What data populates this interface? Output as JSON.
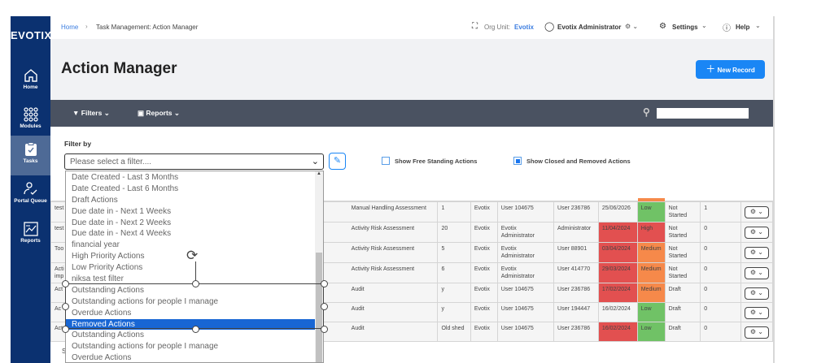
{
  "sidebar": {
    "logo": "EVOTIX",
    "items": [
      {
        "label": "Home",
        "icon": "home-icon"
      },
      {
        "label": "Modules",
        "icon": "grid-icon"
      },
      {
        "label": "Tasks",
        "icon": "clipboard-check-icon",
        "active": true
      },
      {
        "label": "Portal Queue",
        "icon": "user-check-icon"
      },
      {
        "label": "Reports",
        "icon": "chart-icon"
      }
    ]
  },
  "header": {
    "breadcrumb_home": "Home",
    "breadcrumb_current": "Task Management: Action Manager",
    "org_unit_label": "Org Unit:",
    "org_unit_value": "Evotix",
    "user": "Evotix Administrator",
    "settings": "Settings",
    "help": "Help"
  },
  "page": {
    "title": "Action Manager",
    "new_record": "New Record"
  },
  "toolbar": {
    "filters": "Filters",
    "reports": "Reports",
    "search_value": ""
  },
  "filter": {
    "label": "Filter by",
    "placeholder": "Please select a filter....",
    "show_free_standing": "Show Free Standing Actions",
    "show_free_standing_checked": false,
    "show_closed_removed": "Show Closed and Removed Actions",
    "show_closed_removed_checked": true
  },
  "dropdown_options": [
    "Date Created - Last 3 Months",
    "Date Created - Last 6 Months",
    "Draft Actions",
    "Due date in - Next 1 Weeks",
    "Due date in - Next 2 Weeks",
    "Due date in - Next 4 Weeks",
    "financial year",
    "High Priority Actions",
    "Low Priority Actions",
    "niksa test filter",
    "Outstanding Actions",
    "Outstanding actions for people I manage",
    "Overdue Actions",
    "Removed Actions",
    "Outstanding Actions",
    "Outstanding actions for people I manage",
    "Overdue Actions"
  ],
  "dropdown_selected": "Removed Actions",
  "colors": {
    "sidebar": "#0b3170",
    "accent": "#1a86f5",
    "overdue": "#e25050",
    "low": "#70c266",
    "medium": "#f6894a",
    "high": "#e25050"
  },
  "rows": [
    {
      "first": "test",
      "source": "Manual Handling Assessment",
      "ref": "1",
      "org": "Evotix",
      "owner": "User 104675",
      "assignee": "User 236786",
      "due": "25/06/2026",
      "due_overdue": false,
      "priority": "Low",
      "status": "Not Started",
      "count": "1"
    },
    {
      "first": "test",
      "source": "Activity Risk Assessment",
      "ref": "20",
      "org": "Evotix",
      "owner": "Evotix Administrator",
      "assignee": "Administrator",
      "due": "11/04/2024",
      "due_overdue": true,
      "priority": "High",
      "status": "Not Started",
      "count": "0"
    },
    {
      "first": "Too",
      "source": "Activity Risk Assessment",
      "ref": "5",
      "org": "Evotix",
      "owner": "Evotix Administrator",
      "assignee": "User 88901",
      "due": "03/04/2024",
      "due_overdue": true,
      "priority": "Medium",
      "status": "Not Started",
      "count": "0"
    },
    {
      "first": "Acti imp",
      "source": "Activity Risk Assessment",
      "ref": "6",
      "org": "Evotix",
      "owner": "Evotix Administrator",
      "assignee": "User 414770",
      "due": "29/03/2024",
      "due_overdue": true,
      "priority": "Medium",
      "status": "Not Started",
      "count": "0"
    },
    {
      "first": "Act",
      "source": "Audit",
      "ref": "y",
      "org": "Evotix",
      "owner": "User 104675",
      "assignee": "User 236786",
      "due": "17/02/2024",
      "due_overdue": true,
      "priority": "Medium",
      "status": "Draft",
      "count": "0"
    },
    {
      "first": "Ac",
      "source": "Audit",
      "ref": "y",
      "org": "Evotix",
      "owner": "User 104675",
      "assignee": "User 194447",
      "due": "16/02/2024",
      "due_overdue": false,
      "priority": "Low",
      "status": "Draft",
      "count": "0"
    },
    {
      "first": "Act",
      "source": "Audit",
      "ref": "Old shed",
      "org": "Evotix",
      "owner": "User 104675",
      "assignee": "User 236786",
      "due": "16/02/2024",
      "due_overdue": true,
      "priority": "Low",
      "status": "Draft",
      "count": "0"
    }
  ],
  "footer_partial": "S"
}
